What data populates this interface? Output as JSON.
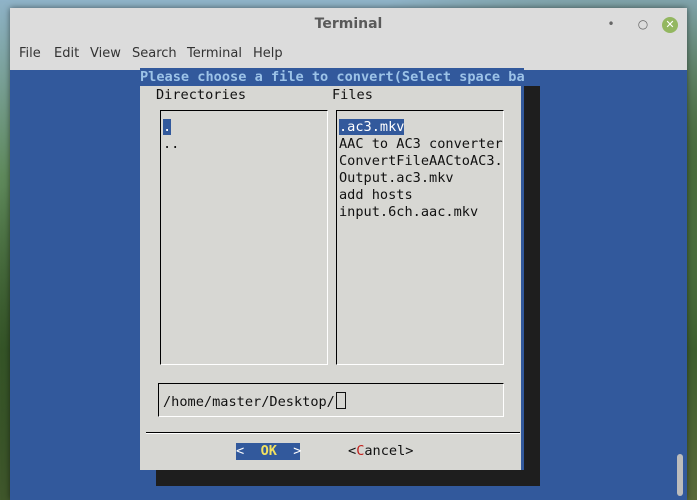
{
  "window": {
    "title": "Terminal",
    "min_glyph": "•",
    "max_glyph": "○",
    "close_glyph": "✕"
  },
  "menubar": {
    "items": [
      "File",
      "Edit",
      "View",
      "Search",
      "Terminal",
      "Help"
    ]
  },
  "dialog": {
    "title": "Please choose a file to convert(Select space bar",
    "directories_label": "Directories",
    "files_label": "Files",
    "directories": [
      ".",
      ".."
    ],
    "selected_directory": 0,
    "files": [
      ".ac3.mkv",
      "AAC to AC3 converter",
      "ConvertFileAACtoAC3.",
      "Output.ac3.mkv",
      "add hosts",
      "input.6ch.aac.mkv"
    ],
    "selected_file": 0,
    "path_value": "/home/master/Desktop/",
    "ok_button": {
      "left": "<  ",
      "hot": "OK",
      "right": "  >"
    },
    "cancel_button": {
      "left": "<",
      "hot": "C",
      "right": "ancel>"
    }
  },
  "colors": {
    "terminal_bg": "#32599c",
    "dialog_bg": "#d7d7d3",
    "selection": "#32599c",
    "title_text": "#9cc3e8",
    "hotkey_ok": "#f2e160",
    "hotkey_cancel": "#c4211c",
    "close_button": "#93b760"
  }
}
